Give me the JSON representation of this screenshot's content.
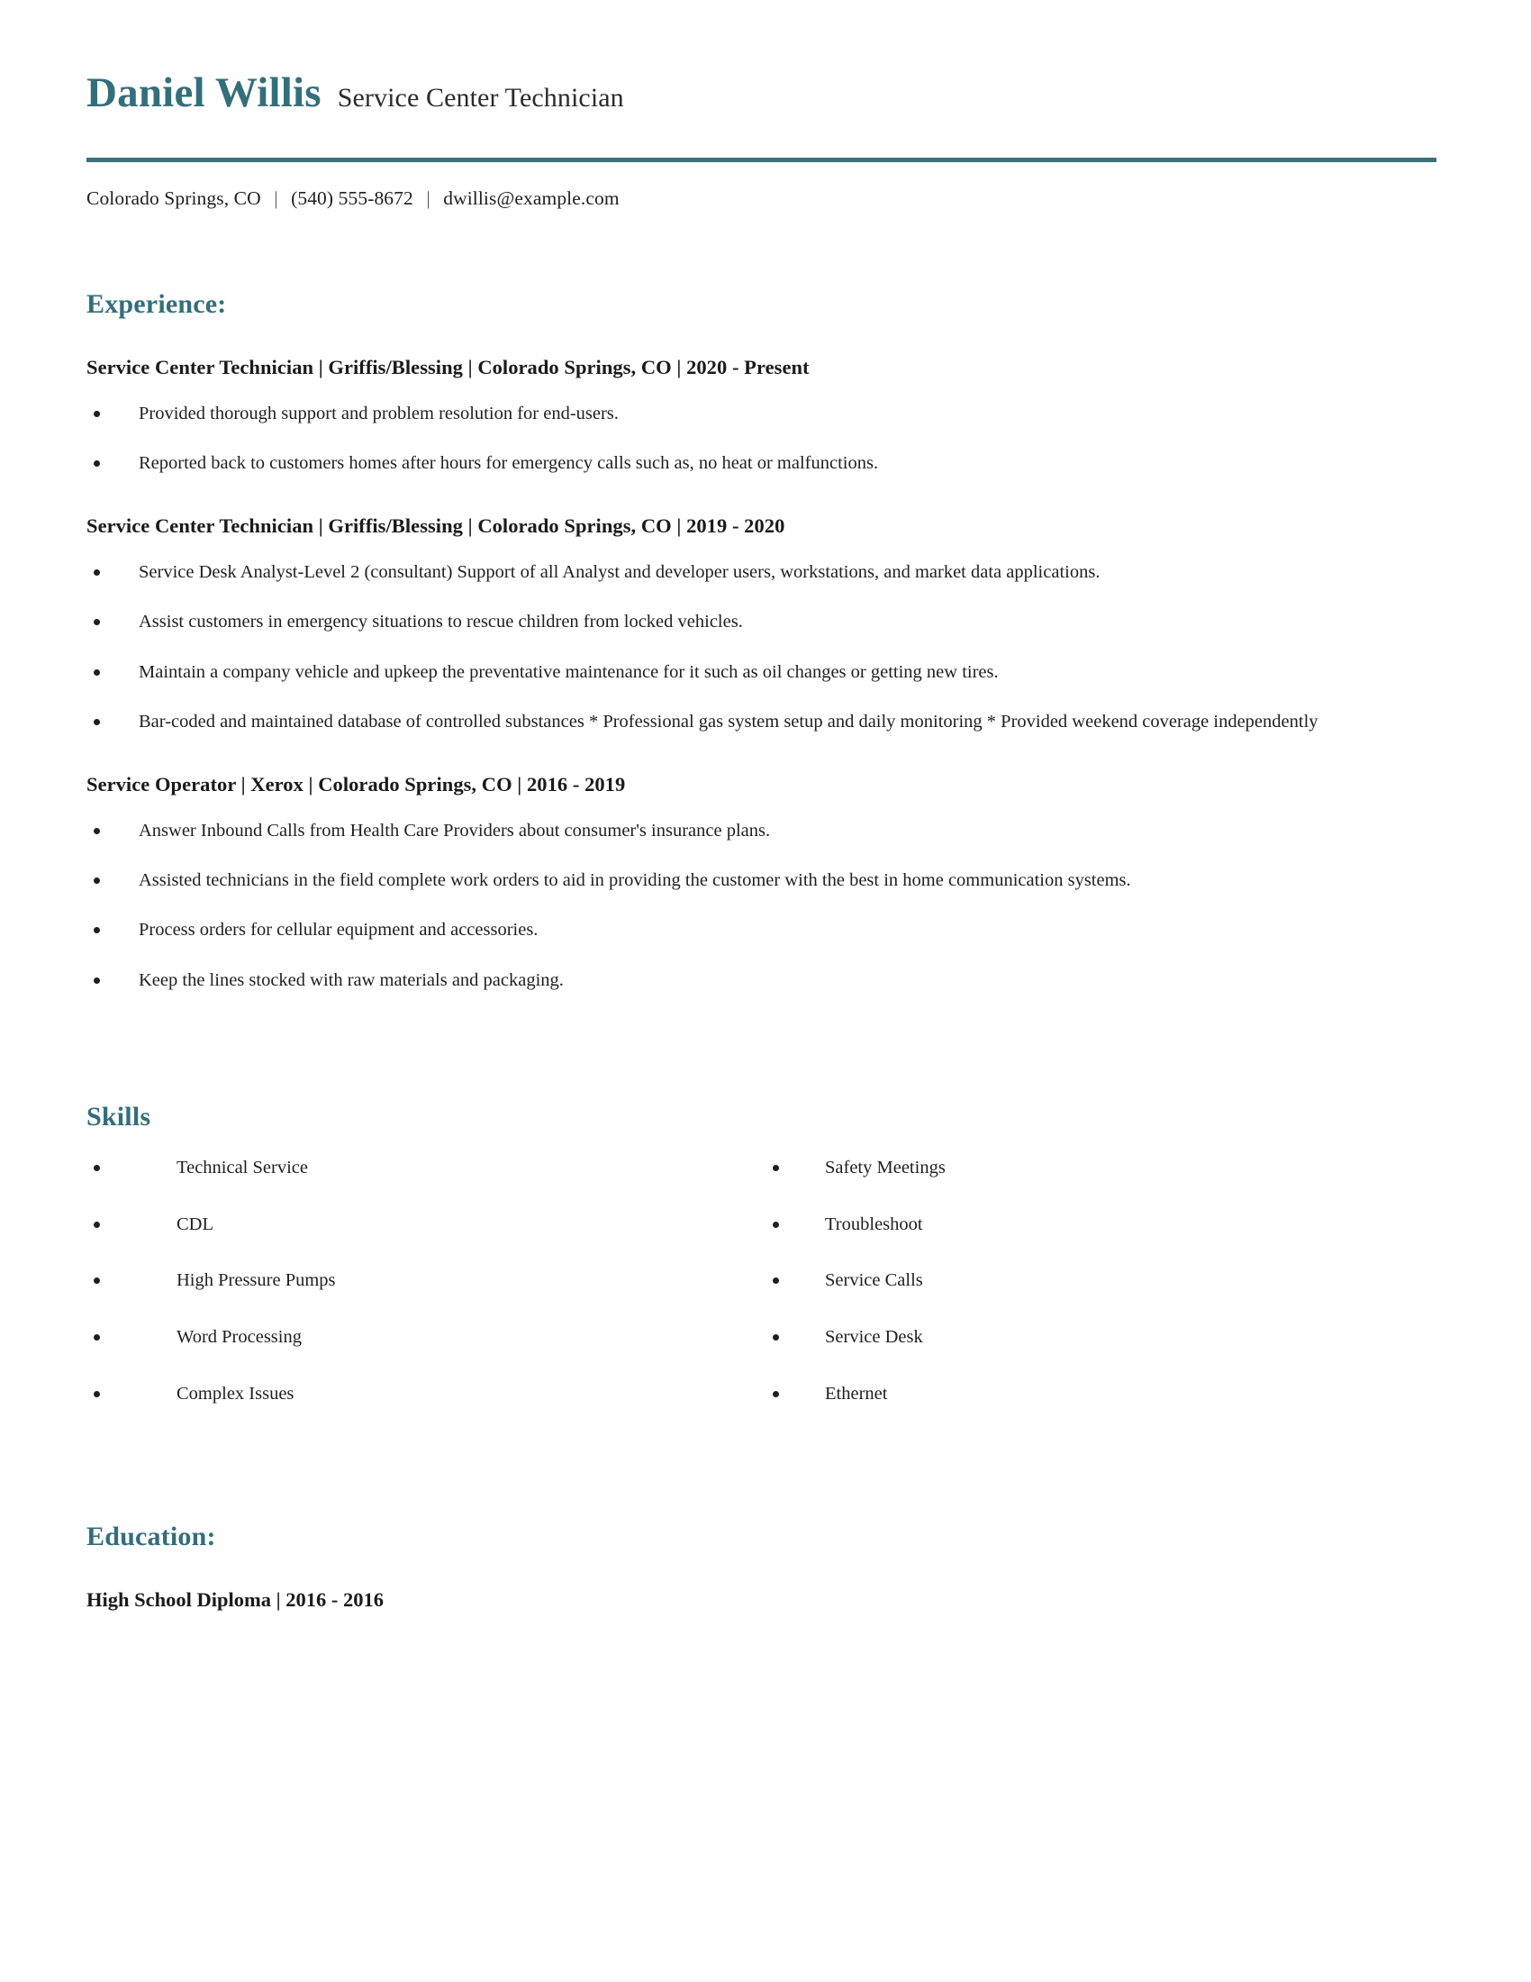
{
  "header": {
    "name": "Daniel Willis",
    "job_title": "Service Center Technician",
    "accent_color": "#336E7B",
    "divider_color": "#3C6F7A"
  },
  "contact": {
    "location": "Colorado Springs, CO",
    "separator_1": "|",
    "phone": "(540) 555-8672",
    "separator_2": "|",
    "email": "dwillis@example.com"
  },
  "experience": {
    "heading": "Experience:",
    "jobs": [
      {
        "heading": "Service Center Technician | Griffis/Blessing | Colorado Springs, CO | 2020 - Present",
        "bullets": [
          "Provided thorough support and problem resolution for end-users.",
          "Reported back to customers homes after hours for emergency calls such as, no heat or malfunctions."
        ]
      },
      {
        "heading": "Service Center Technician | Griffis/Blessing | Colorado Springs, CO | 2019 - 2020",
        "bullets": [
          "Service Desk Analyst-Level 2 (consultant) Support of all Analyst and developer users, workstations, and market data applications.",
          "Assist customers in emergency situations to rescue children from locked vehicles.",
          "Maintain a company vehicle and upkeep the preventative maintenance for it such as oil changes or getting new tires.",
          "Bar-coded and maintained database of controlled substances * Professional gas system setup and daily monitoring * Provided weekend coverage independently"
        ]
      },
      {
        "heading": "Service Operator | Xerox | Colorado Springs, CO | 2016 - 2019",
        "bullets": [
          "Answer Inbound Calls from Health Care Providers about consumer's insurance plans.",
          "Assisted technicians in the field complete work orders to aid in providing the customer with the best in home communication systems.",
          "Process orders for cellular equipment and accessories.",
          "Keep the lines stocked with raw materials and packaging."
        ]
      }
    ]
  },
  "skills": {
    "heading": "Skills",
    "column_left": [
      "Technical Service",
      "CDL",
      "High Pressure Pumps",
      "Word Processing",
      "Complex Issues"
    ],
    "column_right": [
      "Safety Meetings",
      "Troubleshoot",
      "Service Calls",
      "Service Desk",
      "Ethernet"
    ]
  },
  "education": {
    "heading": "Education:",
    "entries": [
      "High School Diploma | 2016 - 2016"
    ]
  }
}
